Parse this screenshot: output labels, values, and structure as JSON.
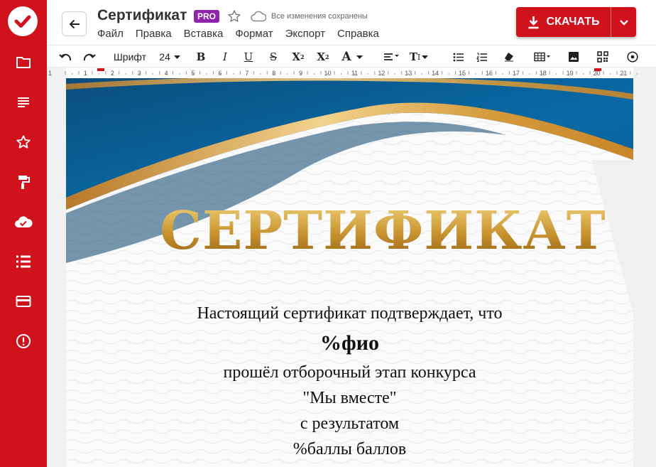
{
  "app": {
    "title": "Сертификат",
    "badge": "PRO",
    "save_status": "Все изменения сохранены",
    "download_label": "СКАЧАТЬ"
  },
  "menu": [
    "Файл",
    "Правка",
    "Вставка",
    "Формат",
    "Экспорт",
    "Справка"
  ],
  "toolbar": {
    "font_label": "Шрифт",
    "font_size": "24"
  },
  "ruler": {
    "numbers": [
      "1",
      "1",
      "2",
      "3",
      "4",
      "5",
      "6",
      "7",
      "8",
      "9",
      "10",
      "11",
      "12",
      "13",
      "14",
      "15",
      "16",
      "17",
      "18",
      "19",
      "20",
      "21"
    ]
  },
  "document": {
    "heading": "СЕРТИФИКАТ",
    "line1": "Настоящий сертификат подтверждает, что",
    "line2": "%фио",
    "line3": "прошёл отборочный этап конкурса",
    "line4": "\"Мы вместе\"",
    "line5": "с результатом",
    "line6": "%баллы баллов"
  },
  "colors": {
    "brand_red": "#d0121d",
    "pro_purple": "#8e24aa",
    "gold": "#c99a3a",
    "blue": "#0a5d94"
  },
  "icons": {
    "rail": [
      "folder-icon",
      "document-lines-icon",
      "star-icon",
      "paint-roller-icon",
      "cloud-check-icon",
      "list-icon",
      "credit-card-icon",
      "alert-icon"
    ]
  }
}
